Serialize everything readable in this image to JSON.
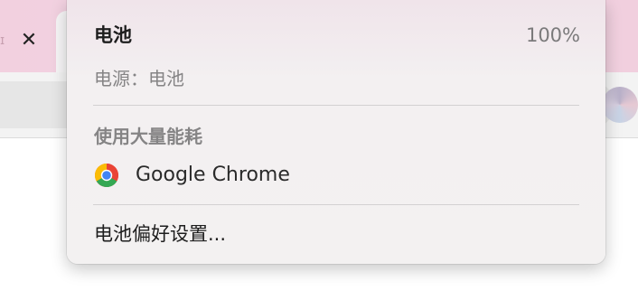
{
  "background": {
    "tab_close_glyph": "✕",
    "tab_fragment_text": "ɪ"
  },
  "battery_menu": {
    "title": "电池",
    "percent": "100%",
    "power_source": "电源：电池",
    "section_heading": "使用大量能耗",
    "apps": [
      {
        "name": "Google Chrome",
        "icon": "chrome-icon"
      }
    ],
    "preferences_label": "电池偏好设置..."
  },
  "colors": {
    "tabstrip_pink": "#f2d0df",
    "menu_background": "#f3f1f1",
    "chrome_red": "#ea4335",
    "chrome_yellow": "#fbbc05",
    "chrome_green": "#34a853",
    "chrome_blue": "#4285f4"
  }
}
